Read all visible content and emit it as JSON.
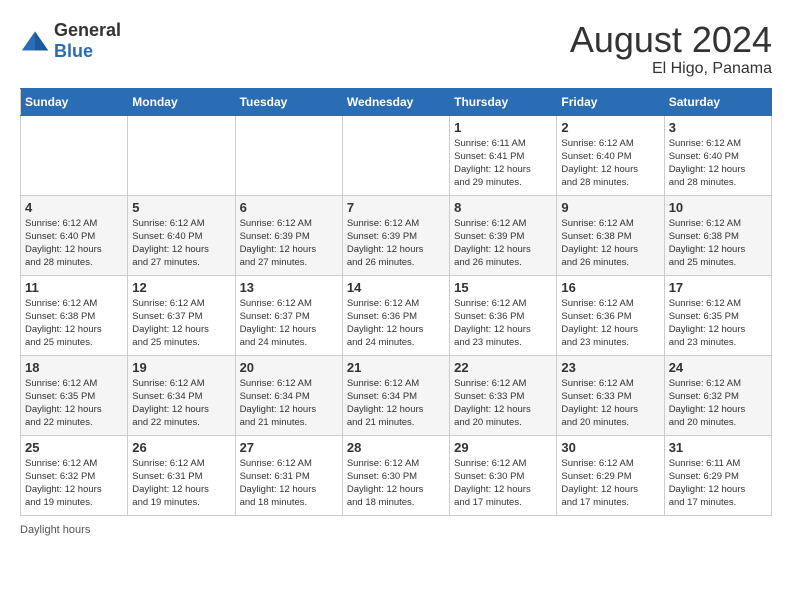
{
  "header": {
    "logo_general": "General",
    "logo_blue": "Blue",
    "title": "August 2024",
    "subtitle": "El Higo, Panama"
  },
  "days_of_week": [
    "Sunday",
    "Monday",
    "Tuesday",
    "Wednesday",
    "Thursday",
    "Friday",
    "Saturday"
  ],
  "weeks": [
    [
      {
        "num": "",
        "info": ""
      },
      {
        "num": "",
        "info": ""
      },
      {
        "num": "",
        "info": ""
      },
      {
        "num": "",
        "info": ""
      },
      {
        "num": "1",
        "info": "Sunrise: 6:11 AM\nSunset: 6:41 PM\nDaylight: 12 hours\nand 29 minutes."
      },
      {
        "num": "2",
        "info": "Sunrise: 6:12 AM\nSunset: 6:40 PM\nDaylight: 12 hours\nand 28 minutes."
      },
      {
        "num": "3",
        "info": "Sunrise: 6:12 AM\nSunset: 6:40 PM\nDaylight: 12 hours\nand 28 minutes."
      }
    ],
    [
      {
        "num": "4",
        "info": "Sunrise: 6:12 AM\nSunset: 6:40 PM\nDaylight: 12 hours\nand 28 minutes."
      },
      {
        "num": "5",
        "info": "Sunrise: 6:12 AM\nSunset: 6:40 PM\nDaylight: 12 hours\nand 27 minutes."
      },
      {
        "num": "6",
        "info": "Sunrise: 6:12 AM\nSunset: 6:39 PM\nDaylight: 12 hours\nand 27 minutes."
      },
      {
        "num": "7",
        "info": "Sunrise: 6:12 AM\nSunset: 6:39 PM\nDaylight: 12 hours\nand 26 minutes."
      },
      {
        "num": "8",
        "info": "Sunrise: 6:12 AM\nSunset: 6:39 PM\nDaylight: 12 hours\nand 26 minutes."
      },
      {
        "num": "9",
        "info": "Sunrise: 6:12 AM\nSunset: 6:38 PM\nDaylight: 12 hours\nand 26 minutes."
      },
      {
        "num": "10",
        "info": "Sunrise: 6:12 AM\nSunset: 6:38 PM\nDaylight: 12 hours\nand 25 minutes."
      }
    ],
    [
      {
        "num": "11",
        "info": "Sunrise: 6:12 AM\nSunset: 6:38 PM\nDaylight: 12 hours\nand 25 minutes."
      },
      {
        "num": "12",
        "info": "Sunrise: 6:12 AM\nSunset: 6:37 PM\nDaylight: 12 hours\nand 25 minutes."
      },
      {
        "num": "13",
        "info": "Sunrise: 6:12 AM\nSunset: 6:37 PM\nDaylight: 12 hours\nand 24 minutes."
      },
      {
        "num": "14",
        "info": "Sunrise: 6:12 AM\nSunset: 6:36 PM\nDaylight: 12 hours\nand 24 minutes."
      },
      {
        "num": "15",
        "info": "Sunrise: 6:12 AM\nSunset: 6:36 PM\nDaylight: 12 hours\nand 23 minutes."
      },
      {
        "num": "16",
        "info": "Sunrise: 6:12 AM\nSunset: 6:36 PM\nDaylight: 12 hours\nand 23 minutes."
      },
      {
        "num": "17",
        "info": "Sunrise: 6:12 AM\nSunset: 6:35 PM\nDaylight: 12 hours\nand 23 minutes."
      }
    ],
    [
      {
        "num": "18",
        "info": "Sunrise: 6:12 AM\nSunset: 6:35 PM\nDaylight: 12 hours\nand 22 minutes."
      },
      {
        "num": "19",
        "info": "Sunrise: 6:12 AM\nSunset: 6:34 PM\nDaylight: 12 hours\nand 22 minutes."
      },
      {
        "num": "20",
        "info": "Sunrise: 6:12 AM\nSunset: 6:34 PM\nDaylight: 12 hours\nand 21 minutes."
      },
      {
        "num": "21",
        "info": "Sunrise: 6:12 AM\nSunset: 6:34 PM\nDaylight: 12 hours\nand 21 minutes."
      },
      {
        "num": "22",
        "info": "Sunrise: 6:12 AM\nSunset: 6:33 PM\nDaylight: 12 hours\nand 20 minutes."
      },
      {
        "num": "23",
        "info": "Sunrise: 6:12 AM\nSunset: 6:33 PM\nDaylight: 12 hours\nand 20 minutes."
      },
      {
        "num": "24",
        "info": "Sunrise: 6:12 AM\nSunset: 6:32 PM\nDaylight: 12 hours\nand 20 minutes."
      }
    ],
    [
      {
        "num": "25",
        "info": "Sunrise: 6:12 AM\nSunset: 6:32 PM\nDaylight: 12 hours\nand 19 minutes."
      },
      {
        "num": "26",
        "info": "Sunrise: 6:12 AM\nSunset: 6:31 PM\nDaylight: 12 hours\nand 19 minutes."
      },
      {
        "num": "27",
        "info": "Sunrise: 6:12 AM\nSunset: 6:31 PM\nDaylight: 12 hours\nand 18 minutes."
      },
      {
        "num": "28",
        "info": "Sunrise: 6:12 AM\nSunset: 6:30 PM\nDaylight: 12 hours\nand 18 minutes."
      },
      {
        "num": "29",
        "info": "Sunrise: 6:12 AM\nSunset: 6:30 PM\nDaylight: 12 hours\nand 17 minutes."
      },
      {
        "num": "30",
        "info": "Sunrise: 6:12 AM\nSunset: 6:29 PM\nDaylight: 12 hours\nand 17 minutes."
      },
      {
        "num": "31",
        "info": "Sunrise: 6:11 AM\nSunset: 6:29 PM\nDaylight: 12 hours\nand 17 minutes."
      }
    ]
  ],
  "footer": {
    "daylight_label": "Daylight hours"
  }
}
